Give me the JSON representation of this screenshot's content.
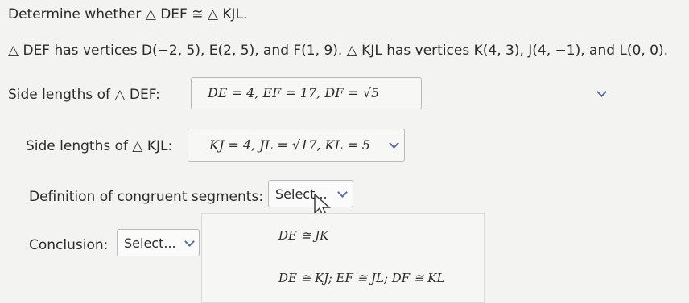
{
  "prompt": {
    "line1": "Determine whether △ DEF ≅ △ KJL.",
    "line2": "△ DEF has vertices D(−2, 5), E(2, 5), and F(1, 9). △ KJL has vertices K(4, 3), J(4, −1), and L(0, 0)."
  },
  "def_side_lengths": {
    "label": "Side lengths of △ DEF:",
    "value": "DE = 4, EF = 17, DF = √5"
  },
  "kjl_side_lengths": {
    "label": "Side lengths of △ KJL:",
    "value": "KJ = 4, JL = √17, KL = 5"
  },
  "definition": {
    "label": "Definition of congruent segments:",
    "selected": "Select..."
  },
  "conclusion": {
    "label": "Conclusion:",
    "selected": "Select..."
  },
  "dropdown_options": [
    "DE ≅ JK",
    "DE ≅ KJ; EF ≅ JL; DF ≅ KL"
  ]
}
